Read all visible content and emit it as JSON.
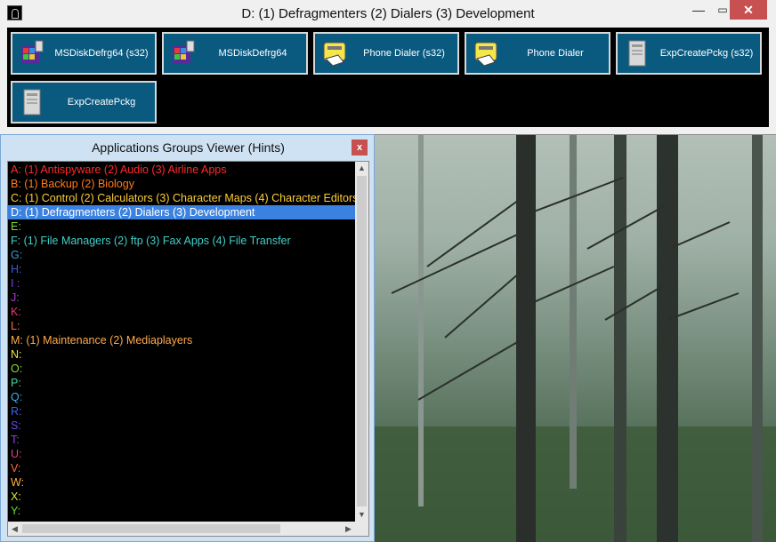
{
  "top_window": {
    "title": "D:  (1) Defragmenters (2) Dialers (3) Development",
    "min_glyph": "—",
    "max_glyph": "▭",
    "close_glyph": "✕"
  },
  "apps": [
    {
      "label": "MSDiskDefrg64 (s32)",
      "icon": "disk-defrag-icon"
    },
    {
      "label": "MSDiskDefrg64",
      "icon": "disk-defrag-icon"
    },
    {
      "label": "Phone Dialer (s32)",
      "icon": "phone-dialer-icon"
    },
    {
      "label": "Phone Dialer",
      "icon": "phone-dialer-icon"
    },
    {
      "label": "ExpCreatePckg (s32)",
      "icon": "package-icon"
    },
    {
      "label": "ExpCreatePckg",
      "icon": "package-icon"
    }
  ],
  "hints_window": {
    "title": "Applications Groups Viewer (Hints)",
    "close_glyph": "x"
  },
  "groups": [
    {
      "text": "A:  (1) Antispyware (2) Audio (3) Airline Apps",
      "color": "#ff2a2a"
    },
    {
      "text": "B:  (1) Backup (2) Biology",
      "color": "#ff7a1a"
    },
    {
      "text": "C:  (1) Control (2) Calculators (3) Character Maps (4) Character Editors",
      "color": "#ffcc33"
    },
    {
      "text": "D:  (1) Defragmenters (2) Dialers (3) Development",
      "color": "#ffffff",
      "selected": true
    },
    {
      "text": "E:",
      "color": "#7cd63c"
    },
    {
      "text": "F:  (1) File Managers (2) ftp (3) Fax Apps (4) File Transfer",
      "color": "#40d0c8"
    },
    {
      "text": "G:",
      "color": "#3a9ad8"
    },
    {
      "text": "H:",
      "color": "#3a5ae8"
    },
    {
      "text": "I :",
      "color": "#7a40e8"
    },
    {
      "text": "J:",
      "color": "#b23ad8"
    },
    {
      "text": "K:",
      "color": "#e83a70"
    },
    {
      "text": "L:",
      "color": "#ff6a4a"
    },
    {
      "text": "M:  (1) Maintenance (2) Mediaplayers",
      "color": "#ffaa4a"
    },
    {
      "text": "N:",
      "color": "#e8e83a"
    },
    {
      "text": "O:",
      "color": "#8ad83a"
    },
    {
      "text": "P:",
      "color": "#3ad8a0"
    },
    {
      "text": "Q:",
      "color": "#3ab0e8"
    },
    {
      "text": "R:",
      "color": "#3a60e8"
    },
    {
      "text": "S:",
      "color": "#6a4ae8"
    },
    {
      "text": "T:",
      "color": "#a23ae8"
    },
    {
      "text": "U:",
      "color": "#e83a8a"
    },
    {
      "text": "V:",
      "color": "#ff6a3a"
    },
    {
      "text": "W:",
      "color": "#ffb03a"
    },
    {
      "text": "X:",
      "color": "#d8e83a"
    },
    {
      "text": "Y:",
      "color": "#6ad83a"
    }
  ],
  "scroll": {
    "up": "▲",
    "down": "▼",
    "left": "◀",
    "right": "▶"
  }
}
